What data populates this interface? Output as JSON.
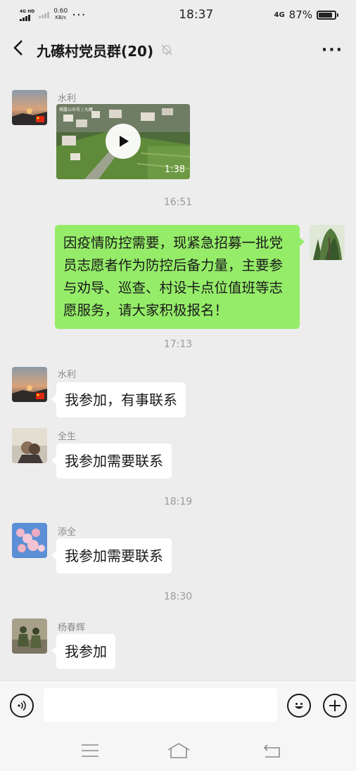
{
  "status_bar": {
    "network": "4G HD",
    "speed_value": "0.60",
    "speed_unit": "KB/s",
    "time": "18:37",
    "network_right": "4G",
    "battery": "87%",
    "battery_level": 0.87
  },
  "header": {
    "title": "九礤村党员群(20)",
    "back_icon": "chevron-left-icon",
    "mute_icon": "bell-off-icon",
    "more_icon": "more-dots-icon"
  },
  "messages": [
    {
      "type": "video",
      "sender": "水利",
      "duration": "1:38",
      "caption": "揭露公众号 | 九礤"
    },
    {
      "type": "time",
      "text": "16:51"
    },
    {
      "type": "text",
      "side": "right",
      "text": "因疫情防控需要，现紧急招募一批党员志愿者作为防控后备力量，主要参与劝导、巡查、村设卡点位值班等志愿服务，请大家积极报名！"
    },
    {
      "type": "time",
      "text": "17:13"
    },
    {
      "type": "text",
      "side": "left",
      "sender": "水利",
      "text": "我参加，有事联系"
    },
    {
      "type": "text",
      "side": "left",
      "sender": "全生",
      "text": "我参加需要联系"
    },
    {
      "type": "time",
      "text": "18:19"
    },
    {
      "type": "text",
      "side": "left",
      "sender": "添全",
      "text": "我参加需要联系"
    },
    {
      "type": "time",
      "text": "18:30"
    },
    {
      "type": "text",
      "side": "left",
      "sender": "杨春辉",
      "text": "我参加"
    }
  ],
  "input_bar": {
    "voice_icon": "voice-icon",
    "emoji_icon": "emoji-icon",
    "plus_icon": "plus-icon",
    "value": ""
  },
  "nav_bar": [
    "menu-icon",
    "home-icon",
    "back-icon"
  ],
  "colors": {
    "bubble_self": "#95ec69",
    "bubble_other": "#ffffff",
    "background": "#ededed"
  }
}
